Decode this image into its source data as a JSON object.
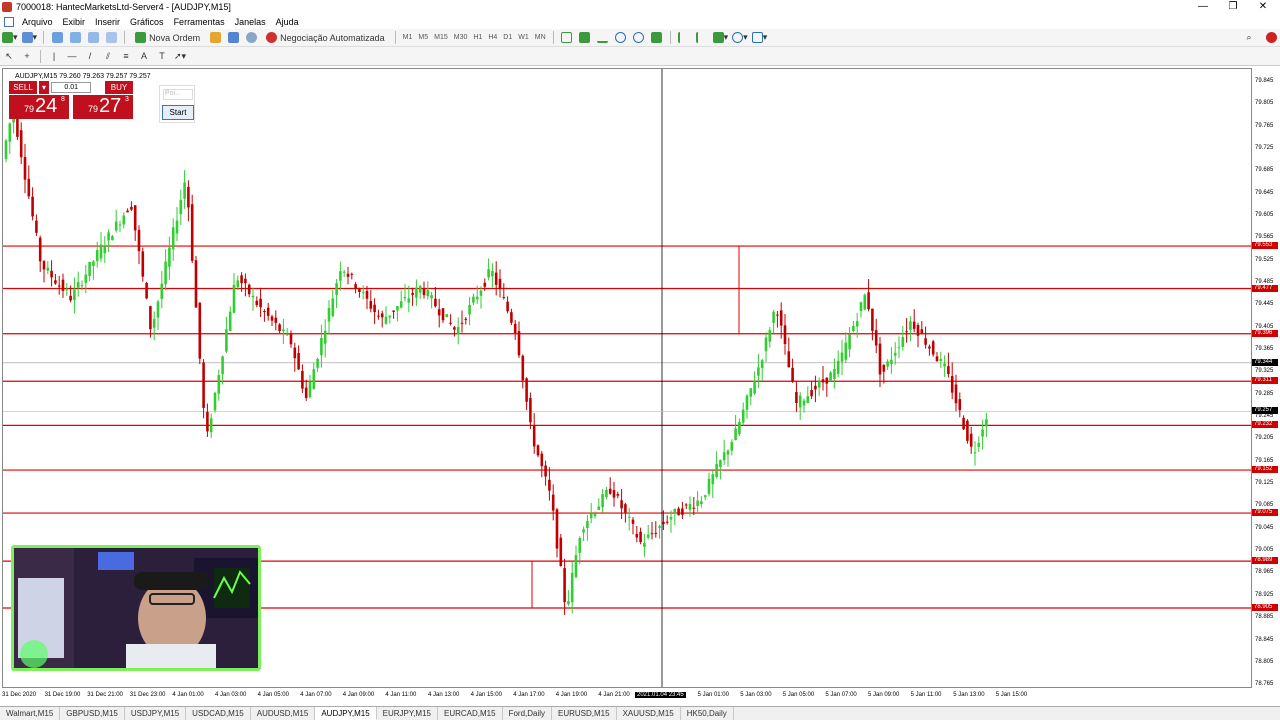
{
  "window": {
    "title": "7000018: HantecMarketsLtd-Server4 - [AUDJPY,M15]",
    "minimize_glyph": "—",
    "restore_glyph": "❐",
    "close_glyph": "✕"
  },
  "menu": [
    "Arquivo",
    "Exibir",
    "Inserir",
    "Gráficos",
    "Ferramentas",
    "Janelas",
    "Ajuda"
  ],
  "toolbar": {
    "new_order": "Nova Ordem",
    "autotrading": "Negociação Automatizada",
    "timeframes": [
      "M1",
      "M5",
      "M15",
      "M30",
      "H1",
      "H4",
      "D1",
      "W1",
      "MN"
    ]
  },
  "chart": {
    "symbol_line": "AUDJPY,M15  79.260 79.263 79.257 79.257",
    "trade_panel": {
      "sell_label": "SELL",
      "buy_label": "BUY",
      "lot": "0.01",
      "sell_small": "79",
      "sell_big": "24",
      "sell_sup": "8",
      "buy_small": "79",
      "buy_big": "27",
      "buy_sup": "3"
    },
    "ea_panel": {
      "edit_placeholder": "Poi...",
      "start_label": "Start"
    },
    "price_labels": [
      "79.845",
      "79.805",
      "79.765",
      "79.725",
      "79.685",
      "79.645",
      "79.605",
      "79.565",
      "79.525",
      "79.485",
      "79.445",
      "79.405",
      "79.365",
      "79.325",
      "79.285",
      "79.245",
      "79.205",
      "79.165",
      "79.125",
      "79.085",
      "79.045",
      "79.005",
      "78.965",
      "78.925",
      "78.885",
      "78.845",
      "78.805",
      "78.765"
    ],
    "level_tags": [
      "79.553",
      "79.477",
      "79.396",
      "79.311",
      "79.232",
      "79.152",
      "79.075",
      "78.989",
      "78.905"
    ],
    "current_tag": "79.257",
    "crosshair_tag": "79.344",
    "time_labels": [
      "31 Dec 2020",
      "31 Dec 19:00",
      "31 Dec 21:00",
      "31 Dec 23:00",
      "4 Jan 01:00",
      "4 Jan 03:00",
      "4 Jan 05:00",
      "4 Jan 07:00",
      "4 Jan 09:00",
      "4 Jan 11:00",
      "4 Jan 13:00",
      "4 Jan 15:00",
      "4 Jan 17:00",
      "4 Jan 19:00",
      "4 Jan 21:00",
      "2021.01.04 23:45",
      "5 Jan 01:00",
      "5 Jan 03:00",
      "5 Jan 05:00",
      "5 Jan 07:00",
      "5 Jan 09:00",
      "5 Jan 11:00",
      "5 Jan 13:00",
      "5 Jan 15:00"
    ],
    "colors": {
      "bull": "#32cd32",
      "bear": "#c00000",
      "level": "#e00000",
      "crosshair": "#000000"
    }
  },
  "tabs": [
    "Walmart,M15",
    "GBPUSD,M15",
    "USDJPY,M15",
    "USDCAD,M15",
    "AUDUSD,M15",
    "AUDJPY,M15",
    "EURJPY,M15",
    "EURCAD,M15",
    "Ford,Daily",
    "EURUSD,M15",
    "XAUUSD,M15",
    "HK50,Daily"
  ],
  "active_tab": "AUDJPY,M15"
}
